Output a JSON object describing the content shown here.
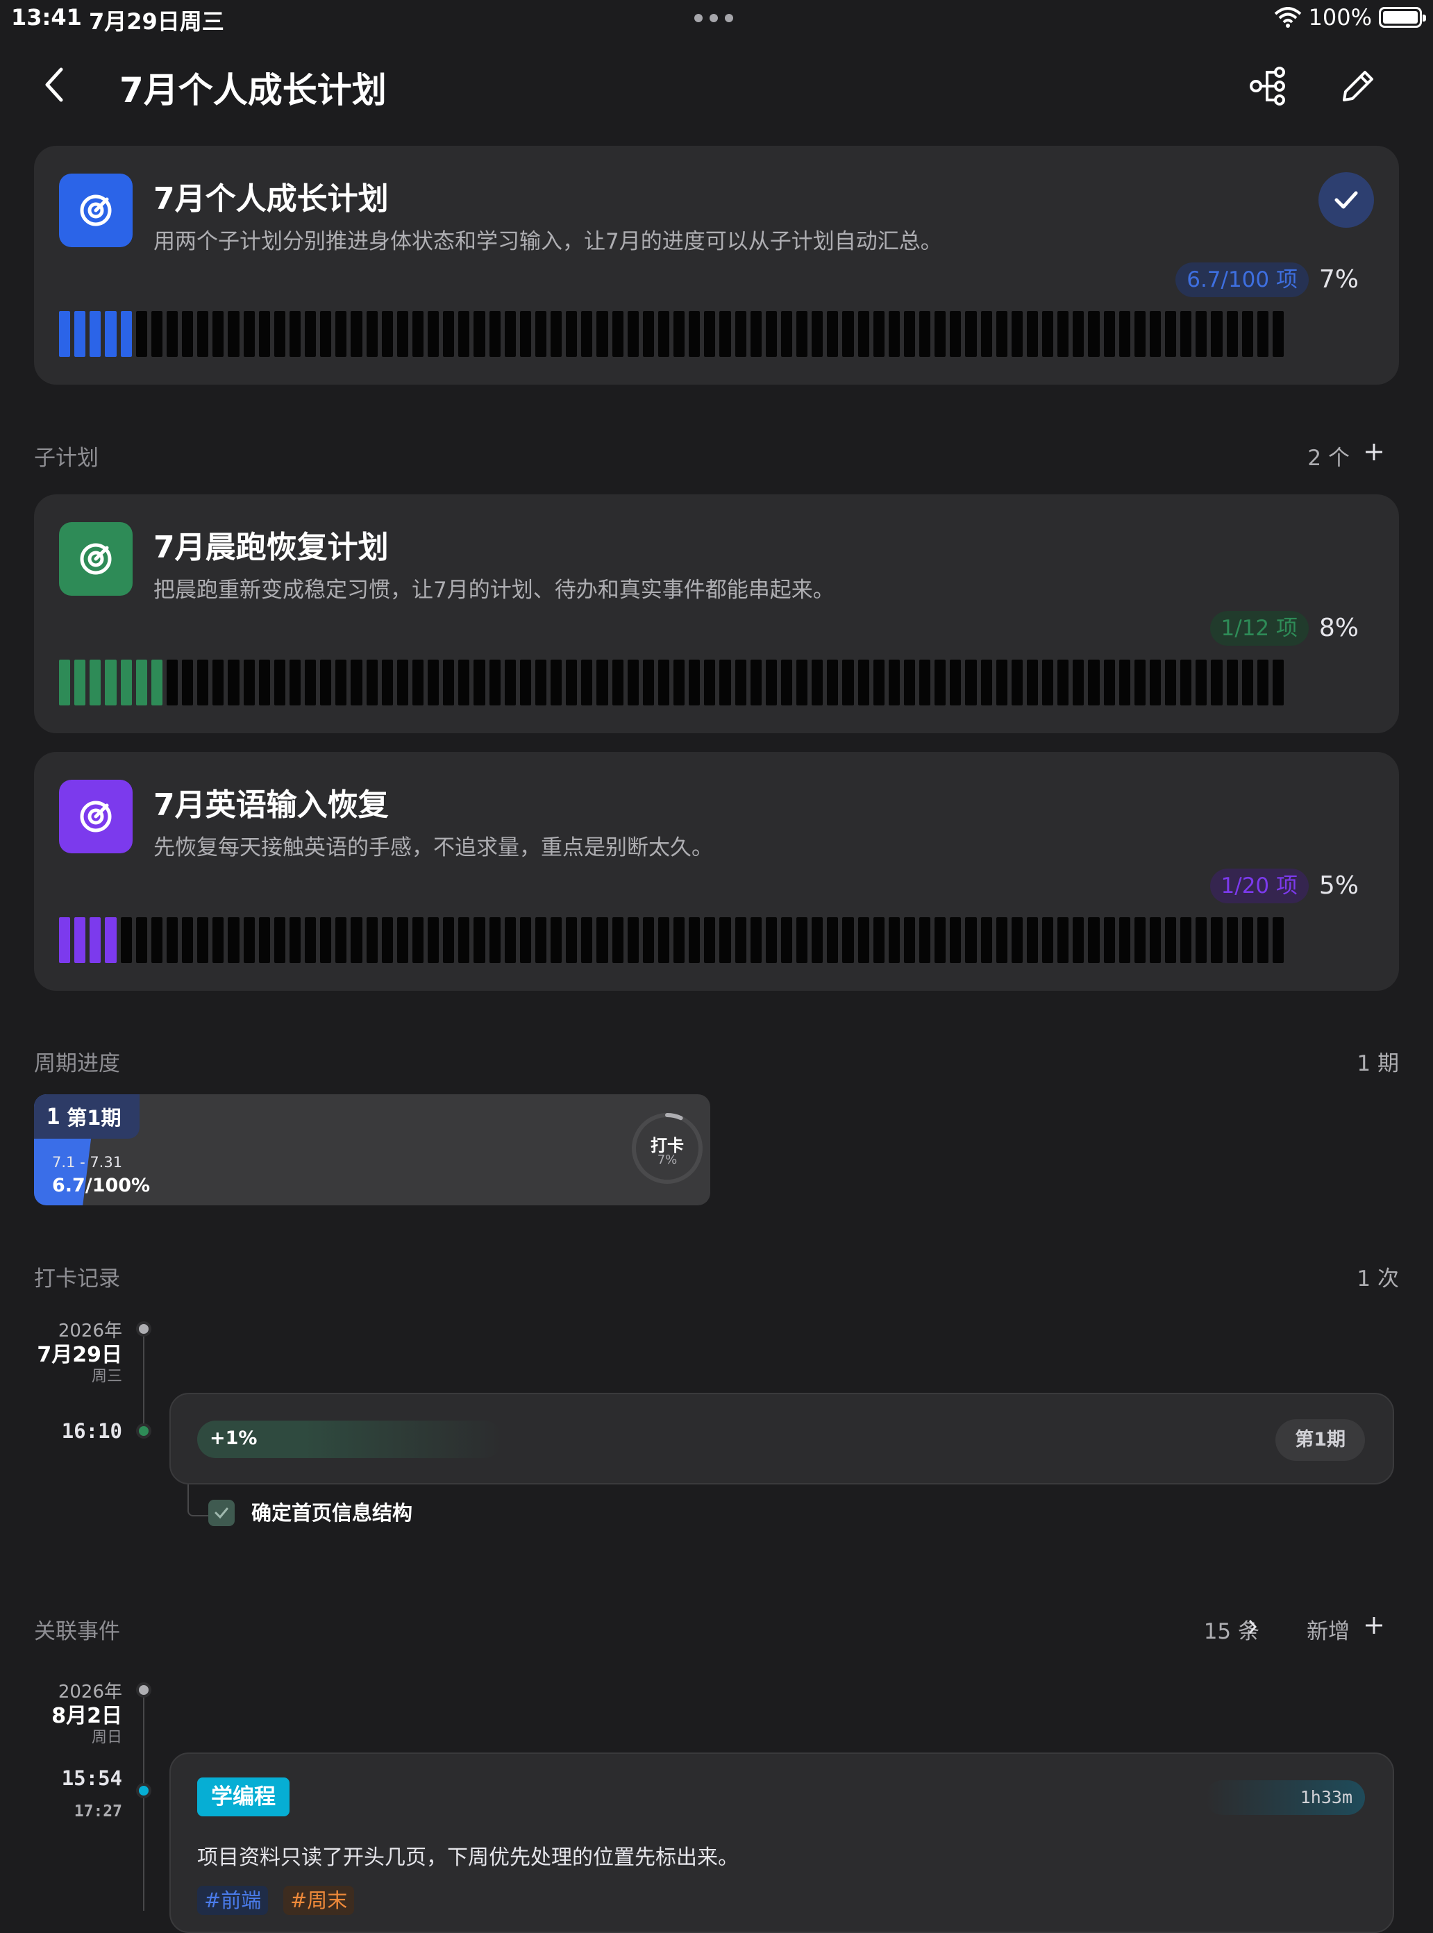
{
  "status_bar": {
    "time": "13:41",
    "date": "7月29日周三",
    "battery": "100%"
  },
  "nav": {
    "title": "7月个人成长计划"
  },
  "main_plan": {
    "title": "7月个人成长计划",
    "description": "用两个子计划分别推进身体状态和学习输入，让7月的进度可以从子计划自动汇总。",
    "count": "6.7/100 项",
    "percent": "7%",
    "progress": 0.067,
    "accent": "#2b64e8"
  },
  "subplans_section": {
    "label": "子计划",
    "count": "2 个"
  },
  "subplans": [
    {
      "title": "7月晨跑恢复计划",
      "description": "把晨跑重新变成稳定习惯，让7月的计划、待办和真实事件都能串起来。",
      "count": "1/12 项",
      "percent": "8%",
      "progress": 0.083,
      "accent": "#2e8b57"
    },
    {
      "title": "7月英语输入恢复",
      "description": "先恢复每天接触英语的手感，不追求量，重点是别断太久。",
      "count": "1/20 项",
      "percent": "5%",
      "progress": 0.05,
      "accent": "#7c3aed"
    }
  ],
  "period_section": {
    "label": "周期进度",
    "count": "1 期"
  },
  "period": {
    "number": "1",
    "name": "第1期",
    "range": "7.1 - 7.31",
    "value": "6.7/100%",
    "checkin_label": "打卡",
    "checkin_pct": "7%",
    "progress": 0.067
  },
  "checkin_section": {
    "label": "打卡记录",
    "count": "1 次"
  },
  "checkin": {
    "year": "2026年",
    "date": "7月29日",
    "weekday": "周三",
    "time": "16:10",
    "delta": "+1%",
    "period": "第1期",
    "task": "确定首页信息结构"
  },
  "events_section": {
    "label": "关联事件",
    "count": "15 条",
    "add_label": "新增"
  },
  "event": {
    "year": "2026年",
    "date": "8月2日",
    "weekday": "周日",
    "time_start": "15:54",
    "time_end": "17:27",
    "category": "学编程",
    "duration": "1h33m",
    "description": "项目资料只读了开头几页，下周优先处理的位置先标出来。",
    "tags": [
      "#前端",
      "#周末"
    ]
  }
}
